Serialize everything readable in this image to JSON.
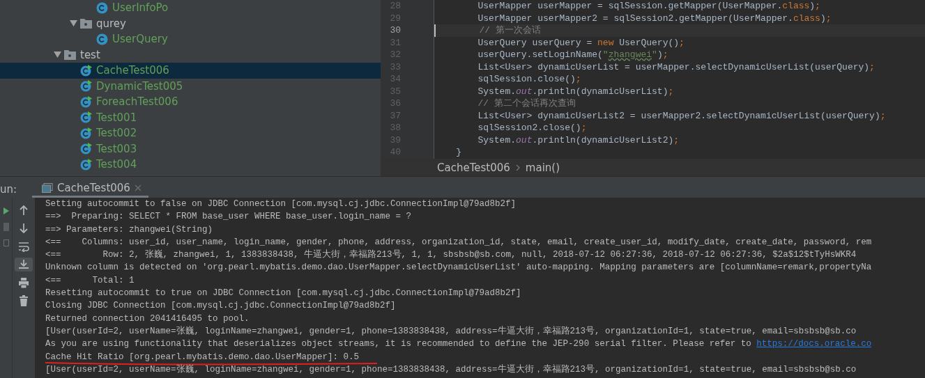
{
  "project_tree": [
    {
      "kind": "cut",
      "children": [
        {
          "kind": "cut",
          "children": [
            {
              "kind": "class",
              "label": "UserInfoPo",
              "selected": false
            }
          ]
        },
        {
          "kind": "folder",
          "label": "qurey",
          "expanded": true,
          "children": [
            {
              "kind": "class",
              "label": "UserQuery",
              "selected": false
            }
          ]
        }
      ]
    },
    {
      "kind": "folder",
      "label": "test",
      "expanded": true,
      "children": [
        {
          "kind": "test_class",
          "label": "CacheTest006",
          "selected": true
        },
        {
          "kind": "test_class",
          "label": "DynamicTest005",
          "selected": false
        },
        {
          "kind": "test_class",
          "label": "ForeachTest006",
          "selected": false
        },
        {
          "kind": "test_class",
          "label": "Test001",
          "selected": false
        },
        {
          "kind": "test_class",
          "label": "Test002",
          "selected": false
        },
        {
          "kind": "test_class",
          "label": "Test003",
          "selected": false
        },
        {
          "kind": "test_class",
          "label": "Test004",
          "selected": false
        }
      ]
    }
  ],
  "editor": {
    "lines": [
      {
        "number": "28",
        "current": false,
        "tokens": [
          {
            "kind": "plain",
            "t": "        UserMapper userMapper = sqlSession.getMapper(UserMapper."
          },
          {
            "kind": "keyword",
            "t": "class"
          },
          {
            "kind": "plain",
            "t": ")"
          },
          {
            "kind": "keyword",
            "t": ";"
          }
        ]
      },
      {
        "number": "29",
        "current": false,
        "tokens": [
          {
            "kind": "plain",
            "t": "        UserMapper userMapper2 = sqlSession2.getMapper(UserMapper."
          },
          {
            "kind": "keyword",
            "t": "class"
          },
          {
            "kind": "plain",
            "t": ")"
          },
          {
            "kind": "keyword",
            "t": ";"
          }
        ]
      },
      {
        "number": "30",
        "current": true,
        "tokens": [
          {
            "kind": "comment",
            "t": "        // 第一次会话"
          }
        ]
      },
      {
        "number": "31",
        "current": false,
        "tokens": [
          {
            "kind": "plain",
            "t": "        UserQuery userQuery = "
          },
          {
            "kind": "keyword",
            "t": "new"
          },
          {
            "kind": "plain",
            "t": " UserQuery()"
          },
          {
            "kind": "keyword",
            "t": ";"
          }
        ]
      },
      {
        "number": "32",
        "current": false,
        "tokens": [
          {
            "kind": "plain",
            "t": "        userQuery.setLoginName("
          },
          {
            "kind": "string",
            "t": "\""
          },
          {
            "kind": "typo",
            "t": "zhangwei"
          },
          {
            "kind": "string",
            "t": "\""
          },
          {
            "kind": "plain",
            "t": ")"
          },
          {
            "kind": "keyword",
            "t": ";"
          }
        ]
      },
      {
        "number": "33",
        "current": false,
        "tokens": [
          {
            "kind": "plain",
            "t": "        List<User> dynamicUserList = userMapper.selectDynamicUserList(userQuery)"
          },
          {
            "kind": "keyword",
            "t": ";"
          }
        ]
      },
      {
        "number": "34",
        "current": false,
        "tokens": [
          {
            "kind": "plain",
            "t": "        sqlSession.close()"
          },
          {
            "kind": "keyword",
            "t": ";"
          }
        ]
      },
      {
        "number": "35",
        "current": false,
        "tokens": [
          {
            "kind": "plain",
            "t": "        System."
          },
          {
            "kind": "field",
            "t": "out"
          },
          {
            "kind": "plain",
            "t": ".println(dynamicUserList)"
          },
          {
            "kind": "keyword",
            "t": ";"
          }
        ]
      },
      {
        "number": "36",
        "current": false,
        "tokens": [
          {
            "kind": "comment",
            "t": "        // 第二个会话再次查询"
          }
        ]
      },
      {
        "number": "37",
        "current": false,
        "tokens": [
          {
            "kind": "plain",
            "t": "        List<User> dynamicUserList2 = userMapper2.selectDynamicUserList(userQuery)"
          },
          {
            "kind": "keyword",
            "t": ";"
          }
        ]
      },
      {
        "number": "38",
        "current": false,
        "tokens": [
          {
            "kind": "plain",
            "t": "        sqlSession2.close()"
          },
          {
            "kind": "keyword",
            "t": ";"
          }
        ]
      },
      {
        "number": "39",
        "current": false,
        "tokens": [
          {
            "kind": "plain",
            "t": "        System."
          },
          {
            "kind": "field",
            "t": "out"
          },
          {
            "kind": "plain",
            "t": ".println(dynamicUserList2)"
          },
          {
            "kind": "keyword",
            "t": ";"
          }
        ]
      },
      {
        "number": "40",
        "current": false,
        "tokens": [
          {
            "kind": "plain",
            "t": "    }"
          }
        ]
      }
    ],
    "breadcrumbs": [
      "CacheTest006",
      "main()"
    ]
  },
  "run_window": {
    "label": "un:",
    "tabs": [
      {
        "label": "CacheTest006",
        "selected": true
      }
    ],
    "toolbar": [
      {
        "kind": "up",
        "selected": false
      },
      {
        "kind": "down",
        "selected": false
      },
      {
        "kind": "wrap",
        "selected": false
      },
      {
        "kind": "scroll_end",
        "selected": true
      },
      {
        "kind": "print",
        "selected": false
      },
      {
        "kind": "trash",
        "selected": false
      }
    ],
    "console": [
      {
        "text": "Setting autocommit to false on JDBC Connection [com.mysql.cj.jdbc.ConnectionImpl@79ad8b2f]",
        "underlined": false
      },
      {
        "text": "==>  Preparing: SELECT * FROM base_user WHERE base_user.login_name = ?",
        "underlined": false
      },
      {
        "text": "==> Parameters: zhangwei(String)",
        "underlined": false
      },
      {
        "text": "<==    Columns: user_id, user_name, login_name, gender, phone, address, organization_id, state, email, create_user_id, modify_date, create_date, password, rem",
        "underlined": false
      },
      {
        "text": "<==        Row: 2, 张巍, zhangwei, 1, 1383838438, 牛逼大街，幸福路213号, 1, 1, sbsbsb@sb.com, null, 2018-07-12 06:27:36, 2018-07-12 06:27:36, $2a$12$tTyHsWKR4",
        "underlined": false
      },
      {
        "text": "Unknown column is detected on 'org.pearl.mybatis.demo.dao.UserMapper.selectDynamicUserList' auto-mapping. Mapping parameters are [columnName=remark,propertyNa",
        "underlined": false
      },
      {
        "text": "<==      Total: 1",
        "underlined": false
      },
      {
        "text": "Resetting autocommit to true on JDBC Connection [com.mysql.cj.jdbc.ConnectionImpl@79ad8b2f]",
        "underlined": false
      },
      {
        "text": "Closing JDBC Connection [com.mysql.cj.jdbc.ConnectionImpl@79ad8b2f]",
        "underlined": false
      },
      {
        "text": "Returned connection 2041416495 to pool.",
        "underlined": false
      },
      {
        "text": "[User(userId=2, userName=张巍, loginName=zhangwei, gender=1, phone=1383838438, address=牛逼大街，幸福路213号, organizationId=1, state=true, email=sbsbsb@sb.co",
        "underlined": false
      },
      {
        "text": "As you are using functionality that deserializes object streams, it is recommended to define the JEP-290 serial filter. Please refer to ",
        "link": "https://docs.oracle.co",
        "underlined": false
      },
      {
        "text": "Cache Hit Ratio [org.pearl.mybatis.demo.dao.UserMapper]: 0.5",
        "underlined": true
      },
      {
        "text": "[User(userId=2, userName=张巍, loginName=zhangwei, gender=1, phone=1383838438, address=牛逼大街，幸福路213号, organizationId=1, state=true, email=sbsbsb@sb.co",
        "underlined": false
      }
    ]
  }
}
